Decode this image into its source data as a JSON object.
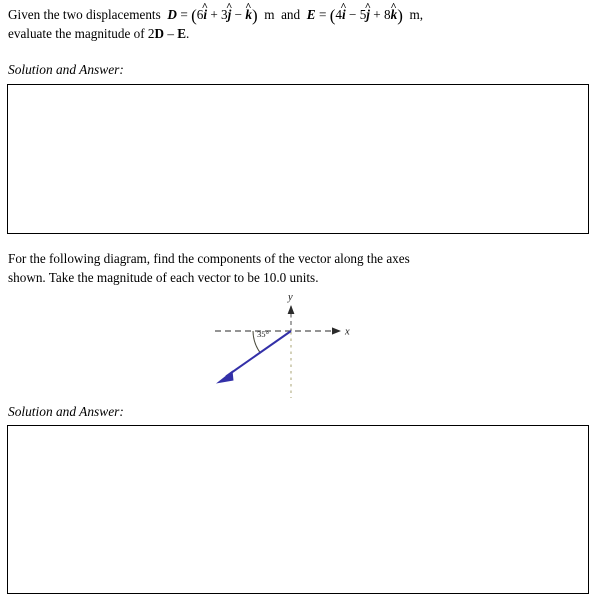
{
  "document": {
    "question1": {
      "line1_pre": "Given  the  two  displacements",
      "vector_d_name": "D",
      "vector_d_expr": "(6î + 3ĵ − k̂)",
      "vector_d_unit": "m",
      "conjunction": "and",
      "vector_e_name": "E",
      "vector_e_expr": "(4î − 5ĵ + 8k̂)",
      "vector_e_unit": "m,",
      "line2": "evaluate the magnitude of 2D − E.",
      "full_text": "Given the two displacements D = (6î + 3ĵ − k̂) m and E = (4î − 5ĵ + 8k̂) m, evaluate the magnitude of 2D − E."
    },
    "solution_label_1": "Solution and Answer:",
    "question2": {
      "line1": "For  the  following  diagram,  find  the  components  of  the  vector  along  the  axes",
      "line2": "shown. Take the magnitude of each vector to be 10.0 units.",
      "full_text": "For the following diagram, find the components of the vector along the axes shown. Take the magnitude of each vector to be 10.0 units."
    },
    "solution_label_2": "Solution and Answer:",
    "diagram": {
      "x_axis_label": "x",
      "y_axis_label": "y",
      "angle_label": "35°",
      "vector_magnitude": "10.0",
      "vector_color": "#3330a8",
      "axis_color": "#555555",
      "dotted_color": "#c9c6a8",
      "arc_color": "#4a4a3c",
      "angle_degrees": 35,
      "vector_direction": "down-left, 35° below the negative x-axis"
    }
  }
}
